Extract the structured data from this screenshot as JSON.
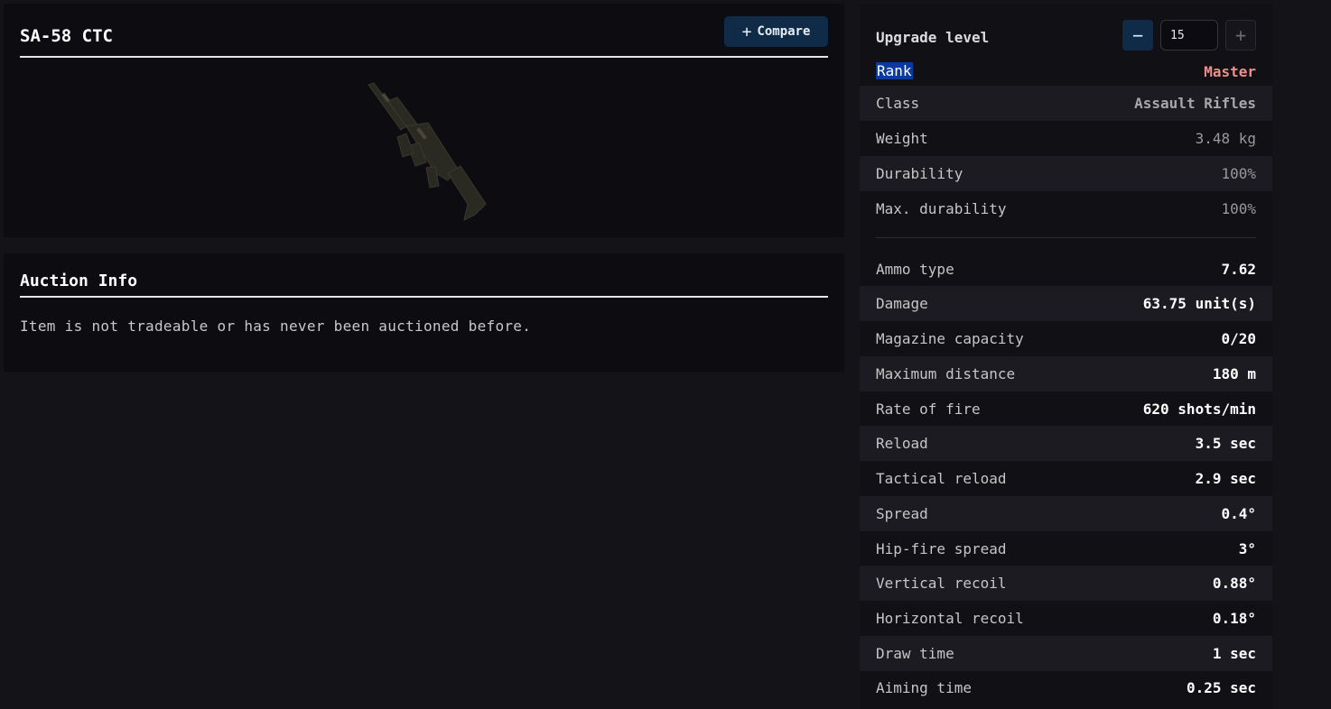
{
  "item": {
    "name": "SA-58 CTC",
    "compare_label": "Compare",
    "weapon_icon": "assault-rifle-image"
  },
  "auction": {
    "title": "Auction Info",
    "message": "Item is not tradeable or has never been auctioned before."
  },
  "upgrade": {
    "label": "Upgrade level",
    "minus": "−",
    "plus": "+",
    "value": "15"
  },
  "rank": {
    "label": "Rank",
    "value": "Master",
    "color": "#f08d8d"
  },
  "basic_stats": [
    {
      "label": "Class",
      "value": "Assault Rifles"
    },
    {
      "label": "Weight",
      "value": "3.48 kg"
    },
    {
      "label": "Durability",
      "value": "100%"
    },
    {
      "label": "Max. durability",
      "value": "100%"
    }
  ],
  "combat_stats": [
    {
      "label": "Ammo type",
      "value": "7.62"
    },
    {
      "label": "Damage",
      "value": "63.75 unit(s)"
    },
    {
      "label": "Magazine capacity",
      "value": "0/20"
    },
    {
      "label": "Maximum distance",
      "value": "180 m"
    },
    {
      "label": "Rate of fire",
      "value": "620 shots/min"
    },
    {
      "label": "Reload",
      "value": "3.5 sec"
    },
    {
      "label": "Tactical reload",
      "value": "2.9 sec"
    },
    {
      "label": "Spread",
      "value": "0.4°"
    },
    {
      "label": "Hip-fire spread",
      "value": "3°"
    },
    {
      "label": "Vertical recoil",
      "value": "0.88°"
    },
    {
      "label": "Horizontal recoil",
      "value": "0.18°"
    },
    {
      "label": "Draw time",
      "value": "1 sec"
    },
    {
      "label": "Aiming time",
      "value": "0.25 sec"
    }
  ],
  "colors": {
    "accent": "#0f2b48",
    "background": "#131318",
    "panel": "#0d0d11"
  }
}
